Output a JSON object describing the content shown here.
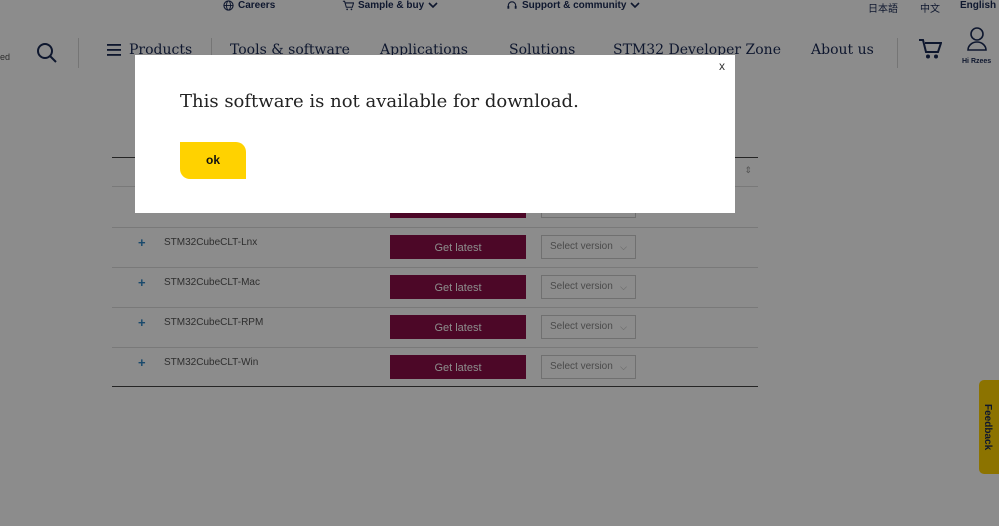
{
  "topbar": {
    "careers": "Careers",
    "sample_buy": "Sample & buy",
    "support": "Support & community",
    "lang_ja": "日本語",
    "lang_zh": "中文",
    "lang_en": "English"
  },
  "nav": {
    "left_text": "ed",
    "products": "Products",
    "tools": "Tools & software",
    "applications": "Applications",
    "solutions": "Solutions",
    "devzone": "STM32 Developer Zone",
    "about": "About us",
    "user_greeting": "Hi Rzees"
  },
  "table": {
    "rows": [
      {
        "plus": "+",
        "name": "STM32CubeCLT-Lnx",
        "action": "Get latest",
        "select": "Select version"
      },
      {
        "plus": "+",
        "name": "STM32CubeCLT-Mac",
        "action": "Get latest",
        "select": "Select version"
      },
      {
        "plus": "+",
        "name": "STM32CubeCLT-RPM",
        "action": "Get latest",
        "select": "Select version"
      },
      {
        "plus": "+",
        "name": "STM32CubeCLT-Win",
        "action": "Get latest",
        "select": "Select version"
      }
    ]
  },
  "modal": {
    "close": "x",
    "message": "This software is not available for download.",
    "ok": "ok"
  },
  "feedback": "Feedback",
  "colors": {
    "accent_yellow": "#ffd200",
    "button_magenta": "#8a0e47",
    "navy": "#1b2a55",
    "plus_blue": "#2e85c5"
  }
}
